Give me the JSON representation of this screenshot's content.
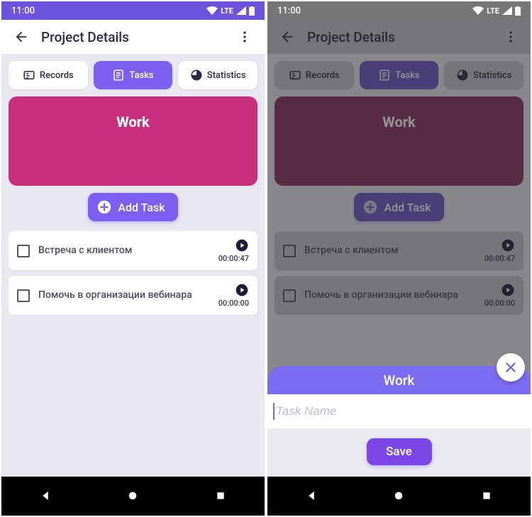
{
  "status": {
    "time": "11:00",
    "net": "LTE"
  },
  "header": {
    "title": "Project Details"
  },
  "tabs": {
    "records": "Records",
    "tasks": "Tasks",
    "statistics": "Statistics"
  },
  "project": {
    "name": "Work"
  },
  "add_task_label": "Add Task",
  "tasks_list": [
    {
      "name": "Встреча с клиентом",
      "time": "00:00:47"
    },
    {
      "name": "Помочь в организации вебинара",
      "time": "00:00:00"
    }
  ],
  "sheet": {
    "title": "Work",
    "placeholder": "Task Name",
    "input_value": "",
    "save_label": "Save"
  }
}
